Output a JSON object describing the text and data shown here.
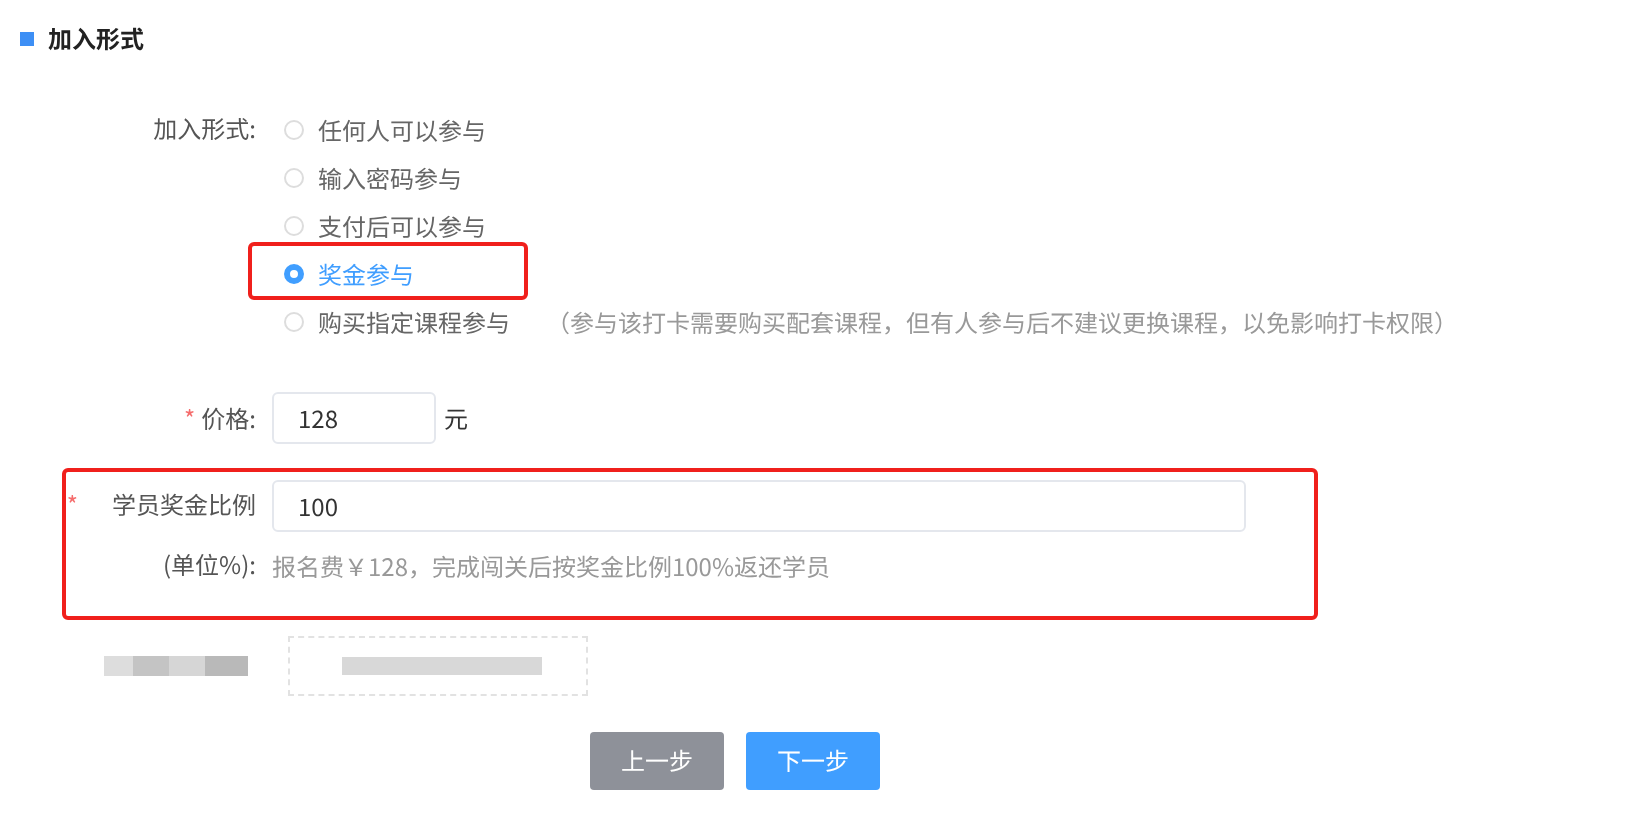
{
  "section_title": "加入形式",
  "join_mode": {
    "label": "加入形式:",
    "options": [
      {
        "label": "任何人可以参与",
        "selected": false
      },
      {
        "label": "输入密码参与",
        "selected": false
      },
      {
        "label": "支付后可以参与",
        "selected": false
      },
      {
        "label": "奖金参与",
        "selected": true
      },
      {
        "label": "购买指定课程参与",
        "selected": false,
        "note": "（参与该打卡需要购买配套课程，但有人参与后不建议更换课程，以免影响打卡权限）"
      }
    ]
  },
  "price": {
    "required_mark": "*",
    "label": "价格:",
    "value": "128",
    "unit": "元"
  },
  "bonus_ratio": {
    "required_mark": "*",
    "label": "学员奖金比例(单位%):",
    "value": "100",
    "hint": "报名费￥128，完成闯关后按奖金比例100%返还学员"
  },
  "buttons": [
    {
      "label": "上一步",
      "kind": "secondary"
    },
    {
      "label": "下一步",
      "kind": "primary"
    }
  ]
}
